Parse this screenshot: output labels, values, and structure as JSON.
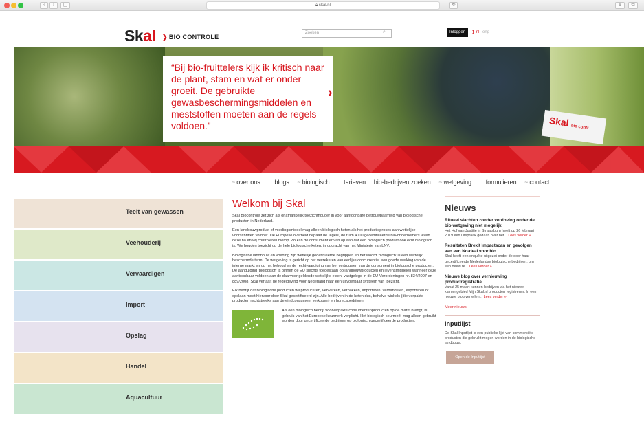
{
  "browser": {
    "url": "skal.nl"
  },
  "header": {
    "logo_text": "Sk",
    "logo_text_k": "al",
    "tagline": "BIO CONTROLE",
    "search_placeholder": "Zoeken",
    "login_label": "Inloggen",
    "lang_current": "nl",
    "lang_other": "eng"
  },
  "hero": {
    "quote": "“Bij bio-fruittelers kijk ik kritisch naar de plant, stam en wat er onder groeit. De gebruikte gewasbeschermingsmiddelen en meststoffen moeten aan de regels voldoen.”",
    "card_text": "Skal",
    "card_text_sub": "bio contr"
  },
  "nav": {
    "items": [
      "over ons",
      "blogs",
      "biologisch",
      "tarieven",
      "bio-bedrijven zoeken",
      "wetgeving",
      "formulieren",
      "contact"
    ]
  },
  "sectors": [
    {
      "label": "Teelt van gewassen",
      "color": "#efe3d6"
    },
    {
      "label": "Veehouderij",
      "color": "#dfe9c9"
    },
    {
      "label": "Vervaardigen",
      "color": "#cbe7e4"
    },
    {
      "label": "Import",
      "color": "#d4e3f1"
    },
    {
      "label": "Opslag",
      "color": "#e7e2ee"
    },
    {
      "label": "Handel",
      "color": "#f3e4c8"
    },
    {
      "label": "Aquacultuur",
      "color": "#c9e6d1"
    }
  ],
  "welcome": {
    "title": "Welkom bij Skal",
    "p1": "Skal Biocontrole zet zich als onafhankelijk toezichthouder in voor aantoonbare betrouwbaarheid van biologische producten in Nederland.",
    "p2": "Een landbouwproduct of voedingsmiddel mag alleen biologisch heten als het productieproces aan wettelijke voorschriften voldoet. De Europese overheid bepaalt de regels, de ruim 4000 gecertificeerde bio-ondernemers leven deze na en wij controleren hierop. Zo kan de consument er van op aan dat een biologisch product ook écht biologisch is. We houden toezicht op de hele biologische keten, in opdracht van het Ministerie van LNV.",
    "p3": "Biologische landbouw en voeding zijn wettelijk gedefinieerde begrippen en het woord ‘biologisch’ is een wettelijk beschermde term. De wetgeving is gericht op het verzekeren van eerlijke concurrentie, een goede werking van de interne markt en op het behoud en de rechtvaardiging van het vertrouwen van de consument in biologische producten. De aanduiding ‘biologisch’ is binnen de EU slechts toegestaan op landbouwproducten en levensmiddelen wanneer deze aantoonbaar voldoen aan de daarvoor geldende wettelijke eisen, vastgelegd in de EU-Verordeningen nr. 834/2007 en 889/2008. Skal vertaalt de regelgeving voor Nederland naar een uitvoerbaar systeem van toezicht.",
    "p4": "Elk bedrijf dat biologische producten wil produceren, verwerken, verpakken, importeren, verhandelen, exporteren of opslaan moet hiervoor door Skal gecertificeerd zijn. Alle bedrijven in de keten dus, behalve winkels (die verpakte producten rechtstreeks aan de eindconsument verkopen) en horecabedrijven.",
    "eu_text": "Als een biologisch bedrijf voorverpakte consumentenproducten op de markt brengt, is gebruik van het Europese keurmerk verplicht. Het biologisch keurmerk mag alleen gebruikt worden door gecertificeerde bedrijven op biologisch gecertificeerde producten."
  },
  "news": {
    "title": "Nieuws",
    "items": [
      {
        "title": "Ritueel slachten zonder verdoving onder de bio-wetgeving niet mogelijk",
        "body": "Het Hof van Justitie in Straatsburg heeft op 26 februari 2019 een uitspraak gedaan over het...",
        "more": "Lees verder »"
      },
      {
        "title": "Resultaten Brexit Impactscan en gevolgen van een No-deal voor bio",
        "body": "Skal heeft een enquête uitgezet onder de door haar gecertificeerde Nederlandse biologische bedrijven, om een beeld te...",
        "more": "Lees verder »"
      },
      {
        "title": "Nieuwe blog over vernieuwing productregistratie",
        "body": "Vanaf 25 maart kunnen bedrijven via het nieuwe klantengebied Mijn.Skal.nl producten registreren. In een nieuwe blog vertellen...",
        "more": "Lees verder »"
      }
    ],
    "all_link": "Meer nieuws",
    "input_title": "Inputlijst",
    "input_body": "De Skal Inputlijst is een publieke lijst van commerciële producten die gebruikt mogen worden in de biologische landbouw.",
    "input_button": "Open de Inputlijst"
  }
}
